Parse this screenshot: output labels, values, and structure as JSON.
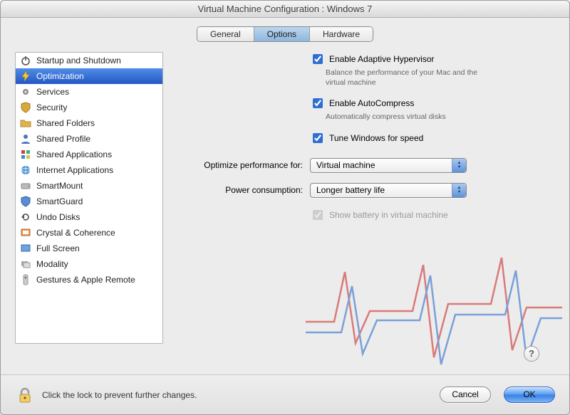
{
  "window": {
    "title": "Virtual Machine Configuration : Windows 7"
  },
  "tabs": {
    "general": "General",
    "options": "Options",
    "hardware": "Hardware",
    "active": "options"
  },
  "sidebar": {
    "items": [
      {
        "label": "Startup and Shutdown",
        "icon": "power-icon"
      },
      {
        "label": "Optimization",
        "icon": "bolt-icon",
        "selected": true
      },
      {
        "label": "Services",
        "icon": "gear-icon"
      },
      {
        "label": "Security",
        "icon": "shield-icon"
      },
      {
        "label": "Shared Folders",
        "icon": "folder-icon"
      },
      {
        "label": "Shared Profile",
        "icon": "profile-icon"
      },
      {
        "label": "Shared Applications",
        "icon": "apps-icon"
      },
      {
        "label": "Internet Applications",
        "icon": "globe-icon"
      },
      {
        "label": "SmartMount",
        "icon": "drive-icon"
      },
      {
        "label": "SmartGuard",
        "icon": "guard-icon"
      },
      {
        "label": "Undo Disks",
        "icon": "undo-icon"
      },
      {
        "label": "Crystal & Coherence",
        "icon": "crystal-icon"
      },
      {
        "label": "Full Screen",
        "icon": "fullscreen-icon"
      },
      {
        "label": "Modality",
        "icon": "modality-icon"
      },
      {
        "label": "Gestures & Apple Remote",
        "icon": "remote-icon"
      }
    ]
  },
  "opts": {
    "hypervisor_label": "Enable Adaptive Hypervisor",
    "hypervisor_hint": "Balance the performance of your Mac and the virtual machine",
    "autocompress_label": "Enable AutoCompress",
    "autocompress_hint": "Automatically compress virtual disks",
    "tune_label": "Tune Windows for speed",
    "perf_label": "Optimize performance for:",
    "perf_value": "Virtual machine",
    "power_label": "Power consumption:",
    "power_value": "Longer battery life",
    "battery_label": "Show battery in virtual machine"
  },
  "footer": {
    "text": "Click the lock to prevent further changes.",
    "cancel": "Cancel",
    "ok": "OK"
  }
}
